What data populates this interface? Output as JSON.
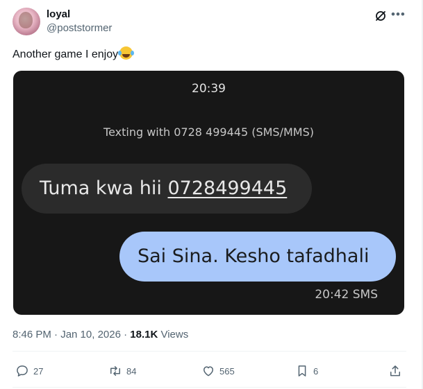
{
  "author": {
    "display_name": "loyal",
    "handle": "@poststormer"
  },
  "tweet": {
    "text": "Another game I enjoy",
    "emoji": "face-with-tears-of-joy"
  },
  "media": {
    "time": "20:39",
    "texting_with": "Texting with 0728 499445 (SMS/MMS)",
    "incoming_prefix": "Tuma kwa hii ",
    "incoming_number": "0728499445",
    "outgoing": "Sai Sina. Kesho tafadhali",
    "outgoing_meta": "20:42 SMS"
  },
  "meta": {
    "timestamp": "8:46 PM · Jan 10, 2026 · ",
    "views_count": "18.1K",
    "views_label": " Views"
  },
  "actions": {
    "replies": "27",
    "reposts": "84",
    "likes": "565",
    "bookmarks": "6"
  },
  "colors": {
    "media_bg": "#171717",
    "incoming_bubble": "#2b2b2b",
    "outgoing_bubble": "#a8c7fa",
    "secondary_text": "#536471"
  },
  "icons": [
    "grok-icon",
    "more-icon",
    "reply-icon",
    "repost-icon",
    "like-icon",
    "bookmark-icon",
    "share-icon"
  ]
}
